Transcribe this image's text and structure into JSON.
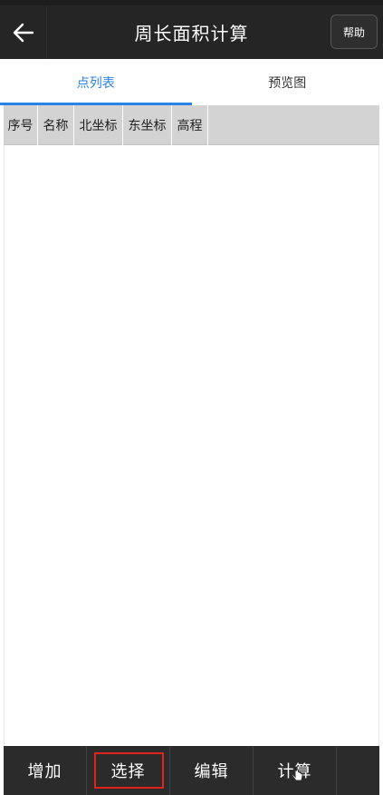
{
  "header": {
    "title": "周长面积计算",
    "help_label": "帮助",
    "back_icon": "arrow-left-icon"
  },
  "tabs": [
    {
      "label": "点列表",
      "active": true
    },
    {
      "label": "预览图",
      "active": false
    }
  ],
  "table": {
    "columns": [
      "序号",
      "名称",
      "北坐标",
      "东坐标",
      "高程"
    ],
    "rows": []
  },
  "toolbar": {
    "buttons": [
      {
        "label": "增加",
        "highlighted": false
      },
      {
        "label": "选择",
        "highlighted": true
      },
      {
        "label": "编辑",
        "highlighted": false
      },
      {
        "label": "计算",
        "highlighted": false
      }
    ]
  },
  "colors": {
    "accent": "#2a82e4",
    "titlebar": "#252525",
    "bottombar": "#2b2b2b",
    "highlight_box": "#e0241b",
    "table_header": "#d3d3d3"
  }
}
